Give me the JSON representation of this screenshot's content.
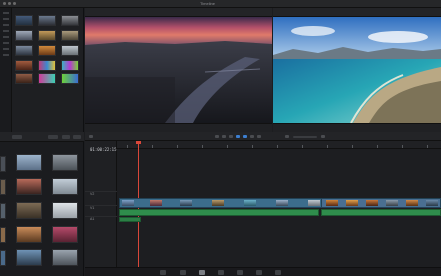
{
  "window": {
    "title": "Timeline"
  },
  "viewers": {
    "source_label": "",
    "program_label": ""
  },
  "timeline": {
    "timecode": "01:00:22:15",
    "tracks": [
      "V2",
      "V1",
      "A1"
    ]
  },
  "colors": {
    "accent": "#3c7fd1",
    "playhead": "#d9473a",
    "video_clip": "#3c6d8c",
    "audio_clip": "#2f8d4c"
  },
  "icons": [
    "gear-icon",
    "search-icon",
    "list-view-icon",
    "grid-view-icon",
    "blade-icon",
    "selection-icon",
    "snapping-icon",
    "link-icon",
    "zoom-icon"
  ],
  "pages": [
    "media",
    "cut",
    "edit",
    "fusion",
    "color",
    "fairlight",
    "deliver"
  ],
  "active_page": "edit"
}
